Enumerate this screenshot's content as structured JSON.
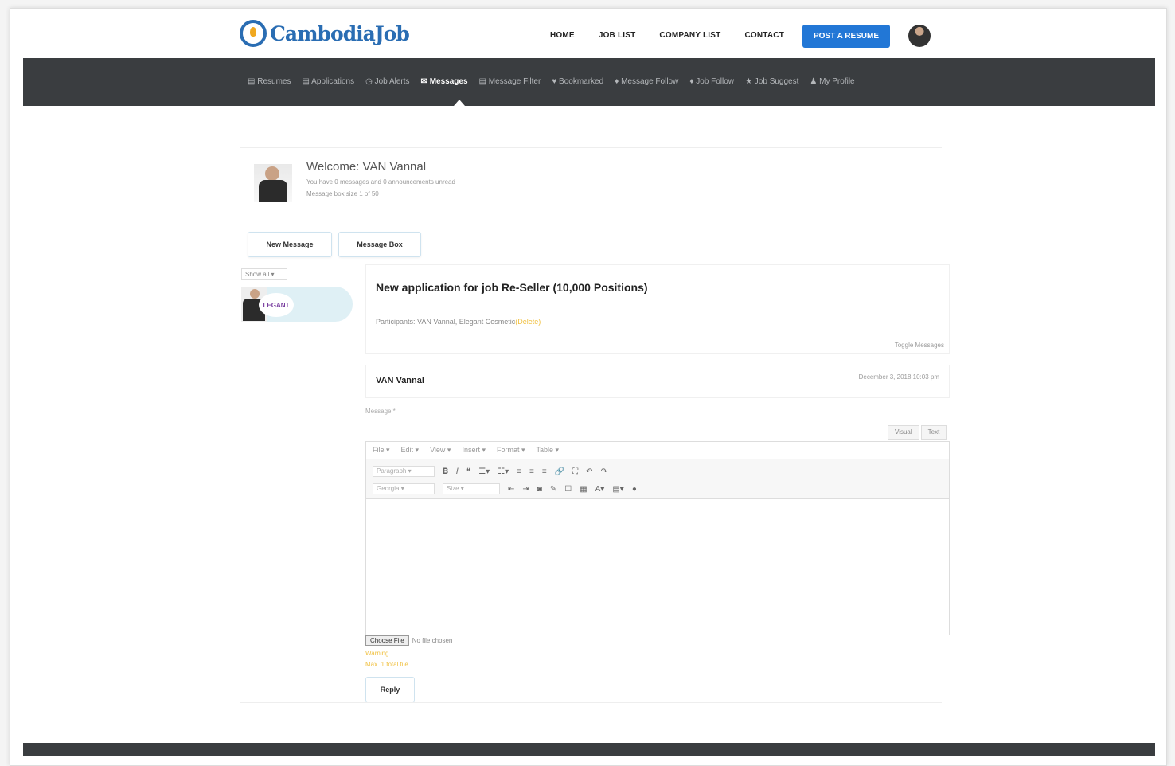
{
  "header": {
    "logo_text": "CambodiaJob",
    "nav": [
      "HOME",
      "JOB LIST",
      "COMPANY LIST",
      "CONTACT"
    ],
    "post_button": "POST A RESUME"
  },
  "subnav": {
    "items": [
      {
        "icon": "▤",
        "label": "Resumes",
        "active": false
      },
      {
        "icon": "▤",
        "label": "Applications",
        "active": false
      },
      {
        "icon": "◷",
        "label": "Job Alerts",
        "active": false
      },
      {
        "icon": "✉",
        "label": "Messages",
        "active": true
      },
      {
        "icon": "▤",
        "label": "Message Filter",
        "active": false
      },
      {
        "icon": "♥",
        "label": "Bookmarked",
        "active": false
      },
      {
        "icon": "♦",
        "label": "Message Follow",
        "active": false
      },
      {
        "icon": "♦",
        "label": "Job Follow",
        "active": false
      },
      {
        "icon": "★",
        "label": "Job Suggest",
        "active": false
      },
      {
        "icon": "♟",
        "label": "My Profile",
        "active": false
      }
    ]
  },
  "welcome": {
    "title": "Welcome: VAN Vannal",
    "line1": "You have 0 messages and 0 announcements unread",
    "line2": "Message box size 1 of 50"
  },
  "buttons": {
    "new_message": "New Message",
    "message_box": "Message Box"
  },
  "filter": {
    "show": "Show all"
  },
  "conversation": {
    "logo_text": "LEGANT"
  },
  "thread": {
    "title": "New application for job Re-Seller (10,000 Positions)",
    "participants_label": "Participants: VAN Vannal, Elegant Cosmetic",
    "participants_link": "(Delete)",
    "toggle": "Toggle Messages"
  },
  "message": {
    "sender": "VAN Vannal",
    "date": "December 3, 2018 10:03 pm"
  },
  "reply_form": {
    "label": "Message *",
    "tab_visual": "Visual",
    "tab_text": "Text",
    "menu": [
      "File ▾",
      "Edit ▾",
      "View ▾",
      "Insert ▾",
      "Format ▾",
      "Table ▾"
    ],
    "paragraph_select": "Paragraph",
    "font_select": "Georgia",
    "size_select": "Size",
    "file_button": "Choose File",
    "file_status": "No file chosen",
    "warning1": "Warning",
    "warning2": "Max. 1 total file",
    "reply": "Reply"
  }
}
